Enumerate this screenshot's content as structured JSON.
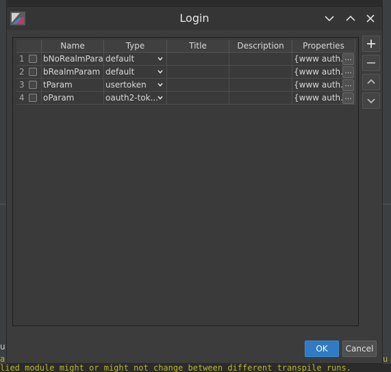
{
  "dialog": {
    "title": "Login",
    "ok_label": "OK",
    "cancel_label": "Cancel"
  },
  "table": {
    "columns": [
      "Name",
      "Type",
      "Title",
      "Description",
      "Properties"
    ],
    "rows": [
      {
        "num": "1",
        "name": "bNoRealmParam",
        "type": "default",
        "title": "",
        "description": "",
        "properties": "{www auth..."
      },
      {
        "num": "2",
        "name": "bRealmParam",
        "type": "default",
        "title": "",
        "description": "",
        "properties": "{www auth..."
      },
      {
        "num": "3",
        "name": "tParam",
        "type": "usertoken",
        "title": "",
        "description": "",
        "properties": "{www auth..."
      },
      {
        "num": "4",
        "name": "oParam",
        "type": "oauth2-tok...",
        "title": "",
        "description": "",
        "properties": "{www auth..."
      }
    ],
    "ellipsis": "..."
  },
  "background": {
    "bottom_text": "lied module might or might not change between different transpile runs.",
    "bottom_left": "a",
    "bottom_right": "u",
    "tab_text": "u"
  },
  "colors": {
    "accent": "#2f7bc4",
    "dialog_bg": "#3c3c3c",
    "titlebar_bg": "#353535"
  },
  "icons": [
    "app-icon",
    "minimize-icon",
    "maximize-icon",
    "close-icon",
    "add-icon",
    "remove-icon",
    "move-up-icon",
    "move-down-icon",
    "dropdown-caret-icon"
  ]
}
